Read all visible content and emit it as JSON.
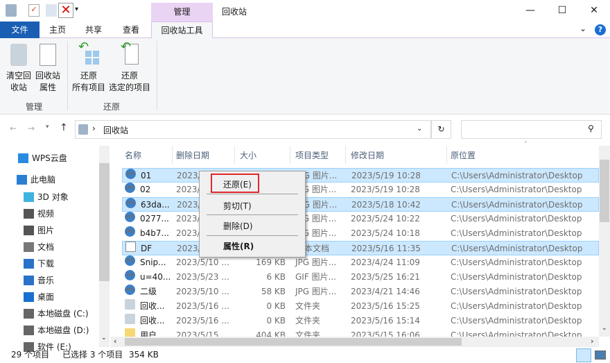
{
  "titlebar": {
    "title": "回收站",
    "context_tab": "管理",
    "minimize": "—",
    "maximize": "☐",
    "close": "✕"
  },
  "tabs": {
    "file": "文件",
    "home": "主页",
    "share": "共享",
    "view": "查看",
    "tools": "回收站工具"
  },
  "ribbon": {
    "empty": [
      "清空回",
      "收站"
    ],
    "props": [
      "回收站",
      "属性"
    ],
    "restore_all": [
      "还原",
      "所有项目"
    ],
    "restore_sel": [
      "还原",
      "选定的项目"
    ],
    "group_manage": "管理",
    "group_restore": "还原"
  },
  "address": {
    "path": "回收站",
    "separator": "›"
  },
  "nav": [
    "WPS云盘",
    "此电脑",
    "3D 对象",
    "视频",
    "图片",
    "文档",
    "下载",
    "音乐",
    "桌面",
    "本地磁盘 (C:)",
    "本地磁盘 (D:)",
    "软件 (E:)"
  ],
  "columns": [
    "名称",
    "删除日期",
    "大小",
    "项目类型",
    "修改日期",
    "原位置"
  ],
  "rows": [
    {
      "name": "01",
      "deleted": "2023/",
      "size": "",
      "type": "JPG 图片...",
      "modified": "2023/5/19 10:28",
      "origin": "C:\\Users\\Administrator\\Desktop",
      "icon": "JPG",
      "sel": true
    },
    {
      "name": "02",
      "deleted": "2023/",
      "size": "",
      "type": "JPG 图片...",
      "modified": "2023/5/19 10:28",
      "origin": "C:\\Users\\Administrator\\Desktop",
      "icon": "JPG",
      "sel": false
    },
    {
      "name": "63da...",
      "deleted": "2023/",
      "size": "",
      "type": "JPG 图片...",
      "modified": "2023/5/18 10:42",
      "origin": "C:\\Users\\Administrator\\Desktop",
      "icon": "JPG",
      "sel": true
    },
    {
      "name": "0277...",
      "deleted": "2023/",
      "size": "",
      "type": "JPG 图片...",
      "modified": "2023/5/24 10:22",
      "origin": "C:\\Users\\Administrator\\Desktop",
      "icon": "JPG",
      "sel": false
    },
    {
      "name": "b4b7...",
      "deleted": "2023/",
      "size": "",
      "type": "JPG 图片...",
      "modified": "2023/5/24 10:18",
      "origin": "C:\\Users\\Administrator\\Desktop",
      "icon": "JPG",
      "sel": false
    },
    {
      "name": "DF",
      "deleted": "2023/",
      "size": "",
      "type": "文本文档",
      "modified": "2023/5/16 11:35",
      "origin": "C:\\Users\\Administrator\\Desktop",
      "icon": "TXT",
      "sel": true
    },
    {
      "name": "Snip...",
      "deleted": "2023/5/10 ...",
      "size": "169 KB",
      "type": "JPG 图片...",
      "modified": "2023/4/24 11:09",
      "origin": "C:\\Users\\Administrator\\Desktop",
      "icon": "JPG",
      "sel": false
    },
    {
      "name": "u=40...",
      "deleted": "2023/5/23 ...",
      "size": "6 KB",
      "type": "GIF 图片...",
      "modified": "2023/5/25 16:21",
      "origin": "C:\\Users\\Administrator\\Desktop",
      "icon": "GIF",
      "sel": false
    },
    {
      "name": "二级",
      "deleted": "2023/5/10 ...",
      "size": "58 KB",
      "type": "JPG 图片...",
      "modified": "2023/4/21 14:46",
      "origin": "C:\\Users\\Administrator\\Desktop",
      "icon": "JPG",
      "sel": false
    },
    {
      "name": "回收...",
      "deleted": "2023/5/16 ...",
      "size": "0 KB",
      "type": "文件夹",
      "modified": "2023/5/16 15:25",
      "origin": "C:\\Users\\Administrator\\Desktop",
      "icon": "BIN",
      "sel": false
    },
    {
      "name": "回收...",
      "deleted": "2023/5/16 ...",
      "size": "0 KB",
      "type": "文件夹",
      "modified": "2023/5/16 15:14",
      "origin": "C:\\Users\\Administrator\\Desktop",
      "icon": "BIN",
      "sel": false
    },
    {
      "name": "用户",
      "deleted": "2023/5/15 ...",
      "size": "404 KB",
      "type": "文件夹",
      "modified": "2023/5/15 16:06",
      "origin": "C:\\Users\\Administrator\\Desktop",
      "icon": "DIR",
      "sel": false
    }
  ],
  "menu": {
    "restore": "还原(E)",
    "cut": "剪切(T)",
    "delete": "删除(D)",
    "properties": "属性(R)"
  },
  "status": {
    "count": "29 个项目",
    "selected": "已选择 3 个项目",
    "size": "354 KB"
  },
  "colors": {
    "accent": "#1a5fb4",
    "selection": "#cce8ff",
    "highlight_box": "#e0262b",
    "context_tab": "#e9d4f3"
  }
}
